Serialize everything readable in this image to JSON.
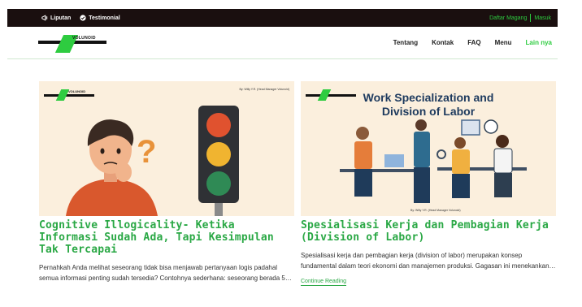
{
  "topbar": {
    "links": [
      {
        "label": "Liputan",
        "icon": "megaphone-icon"
      },
      {
        "label": "Testimonial",
        "icon": "check-circle-icon"
      }
    ],
    "register_label": "Daftar Magang",
    "login_label": "Masuk"
  },
  "brand": {
    "name": "VOLUNOID",
    "accent_color": "#2ecc40"
  },
  "nav": {
    "items": [
      "Tentang",
      "Kontak",
      "FAQ",
      "Menu"
    ],
    "more_label": "Lain nya"
  },
  "posts": [
    {
      "byline": "By: Willy Y.R. (Head Manager Volunoid)",
      "title": "Cognitive Illogicality- Ketika Informasi Sudah Ada, Tapi Kesimpulan Tak Tercapai",
      "excerpt": "Pernahkah Anda melihat seseorang tidak bisa menjawab pertanyaan logis padahal semua informasi penting sudah tersedia? Contohnya sederhana: seseorang berada 5…"
    },
    {
      "image_heading": "Work Specialization and Division of Labor",
      "byline": "By: Willy Y.R. (Head Manager Volunoid)",
      "title": "Spesialisasi Kerja dan Pembagian Kerja (Division of Labor)",
      "excerpt": "Spesialisasi kerja dan pembagian kerja (division of labor) merupakan konsep fundamental dalam teori ekonomi dan manajemen produksi. Gagasan ini menekankan…",
      "read_more": "Continue Reading"
    }
  ]
}
